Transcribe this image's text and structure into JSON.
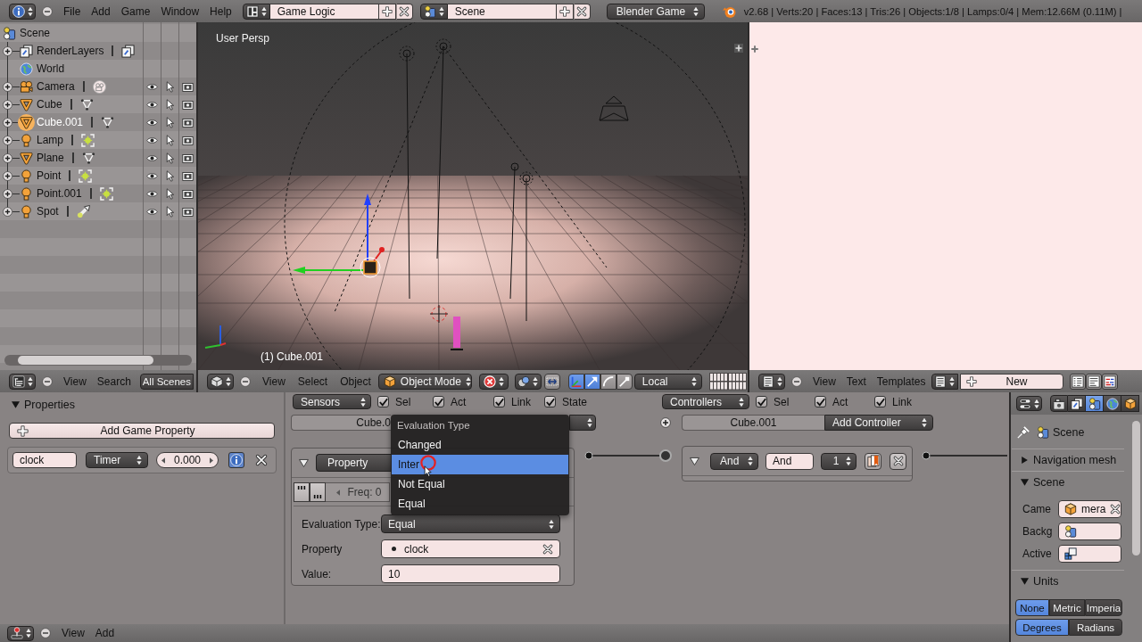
{
  "top_bar": {
    "menus": [
      "File",
      "Add",
      "Game",
      "Window",
      "Help"
    ],
    "screen_layout": "Game Logic",
    "scene": "Scene",
    "render_engine": "Blender Game",
    "stats": "v2.68 | Verts:20 | Faces:13 | Tris:26 | Objects:1/8 | Lamps:0/4 | Mem:12.66M (0.11M) |"
  },
  "outliner": {
    "tree": [
      {
        "label": "Scene",
        "kind": "scene",
        "selected": false,
        "children": [
          {
            "label": "RenderLayers",
            "kind": "render_layers",
            "data": {
              "kind": "render_layer"
            },
            "expanded": false,
            "selected": false
          },
          {
            "label": "World",
            "kind": "world",
            "selected": false
          },
          {
            "label": "Camera",
            "kind": "camera",
            "data": {
              "kind": "camera"
            },
            "expanded": false,
            "selected": false,
            "visible": true,
            "selectable": true,
            "renderable": true
          },
          {
            "label": "Cube",
            "kind": "mesh",
            "data": {
              "kind": "mesh"
            },
            "expanded": false,
            "selected": false,
            "visible": true,
            "selectable": true,
            "renderable": true
          },
          {
            "label": "Cube.001",
            "kind": "mesh",
            "data": {
              "kind": "mesh"
            },
            "expanded": false,
            "selected": true,
            "visible": true,
            "selectable": true,
            "renderable": true
          },
          {
            "label": "Lamp",
            "kind": "lamp",
            "data": {
              "kind": "point_lamp"
            },
            "expanded": false,
            "selected": false,
            "visible": true,
            "selectable": true,
            "renderable": true
          },
          {
            "label": "Plane",
            "kind": "mesh",
            "data": {
              "kind": "mesh"
            },
            "expanded": false,
            "selected": false,
            "visible": true,
            "selectable": true,
            "renderable": true
          },
          {
            "label": "Point",
            "kind": "lamp",
            "data": {
              "kind": "point_lamp"
            },
            "expanded": false,
            "selected": false,
            "visible": true,
            "selectable": true,
            "renderable": true
          },
          {
            "label": "Point.001",
            "kind": "lamp",
            "data": {
              "kind": "point_lamp"
            },
            "expanded": false,
            "selected": false,
            "visible": true,
            "selectable": true,
            "renderable": true
          },
          {
            "label": "Spot",
            "kind": "lamp",
            "data": {
              "kind": "spot_lamp"
            },
            "expanded": false,
            "selected": false,
            "visible": true,
            "selectable": true,
            "renderable": true
          }
        ]
      }
    ],
    "header": {
      "menus": [
        "View",
        "Search"
      ],
      "display_mode": "All Scenes"
    }
  },
  "viewport": {
    "view_name": "User Persp",
    "object_info": "(1) Cube.001",
    "header": {
      "menus": [
        "View",
        "Select",
        "Object"
      ],
      "mode": "Object Mode",
      "manipulator_visible": true,
      "manipulators": [
        {
          "kind": "translate",
          "on": true
        },
        {
          "kind": "rotate",
          "on": false
        },
        {
          "kind": "scale",
          "on": false
        }
      ],
      "orientation": "Local"
    }
  },
  "text_editor": {
    "header": {
      "menus": [
        "View",
        "Text",
        "Templates"
      ],
      "new_button": "New",
      "toggles": [
        {
          "kind": "line_numbers",
          "on": false
        },
        {
          "kind": "word_wrap",
          "on": false
        },
        {
          "kind": "syntax",
          "on": false
        }
      ]
    }
  },
  "logic_editor": {
    "properties_panel": {
      "title": "Properties",
      "expanded": true,
      "add_button": "Add Game Property",
      "game_properties": [
        {
          "name": "clock",
          "type": "Timer",
          "value": "0.000",
          "debug": true
        }
      ]
    },
    "sensors": {
      "header": "Sensors",
      "filters": [
        {
          "label": "Sel",
          "checked": true
        },
        {
          "label": "Act",
          "checked": true
        },
        {
          "label": "Link",
          "checked": true
        },
        {
          "label": "State",
          "checked": true
        }
      ],
      "object": "Cube.0",
      "bricks": [
        {
          "type": "Property",
          "expanded": true,
          "frequency": "Freq: 0",
          "rows": [
            {
              "kind": "dropdown",
              "label": "Evaluation Type:",
              "value": "Equal"
            },
            {
              "kind": "property",
              "label": "Property",
              "value": "clock"
            },
            {
              "kind": "text",
              "label": "Value:",
              "value": "10"
            }
          ]
        }
      ]
    },
    "controllers": {
      "header": "Controllers",
      "filters": [
        {
          "label": "Sel",
          "checked": true
        },
        {
          "label": "Act",
          "checked": true
        },
        {
          "label": "Link",
          "checked": true
        }
      ],
      "object": "Cube.001",
      "add_menu": "Add Controller",
      "bricks": [
        {
          "type": "And",
          "name": "And",
          "state": "1",
          "expanded": true
        }
      ]
    },
    "dropdown_menu": {
      "title": "Evaluation Type",
      "items": [
        {
          "label": "Changed",
          "selected": false
        },
        {
          "label": "Inter",
          "selected": true
        },
        {
          "label": "Not Equal",
          "selected": false
        },
        {
          "label": "Equal",
          "selected": false
        }
      ]
    },
    "header": {
      "menus": [
        "View",
        "Add"
      ]
    }
  },
  "properties_editor": {
    "tabs": [
      {
        "kind": "render",
        "selected": false
      },
      {
        "kind": "render_layers",
        "selected": false
      },
      {
        "kind": "scene",
        "selected": true
      },
      {
        "kind": "world",
        "selected": false
      },
      {
        "kind": "object",
        "selected": false
      }
    ],
    "context": "Scene",
    "panels": [
      {
        "title": "Navigation mesh",
        "expanded": false
      },
      {
        "kind": "fields",
        "title": "Scene",
        "expanded": true,
        "fields": [
          {
            "label": "Came",
            "kind": "object",
            "value": "mera"
          },
          {
            "label": "Backg",
            "kind": "scene"
          },
          {
            "label": "Active",
            "kind": "keying_set"
          }
        ]
      },
      {
        "kind": "units",
        "title": "Units",
        "expanded": true,
        "unit_systems": [
          {
            "label": "None",
            "selected": true
          },
          {
            "label": "Metric",
            "selected": false
          },
          {
            "label": "Imperia",
            "selected": false
          }
        ],
        "rotation_units": [
          {
            "label": "Degrees",
            "selected": true
          },
          {
            "label": "Radians",
            "selected": false
          }
        ]
      }
    ]
  }
}
